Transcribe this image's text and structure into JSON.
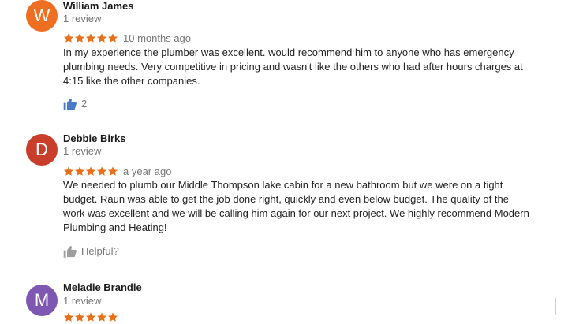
{
  "reviews": [
    {
      "initial": "W",
      "avatar_color": "#ee6e22",
      "name": "William James",
      "count": "1 review",
      "stars": 5,
      "time": "10 months ago",
      "text": "In my experience the plumber was excellent. would recommend him to anyone who has emergency\nplumbing needs. Very competitive in pricing and wasn't like the others who had after hours charges at\n4:15 like the other companies.",
      "helpful": "2",
      "helpful_icon": "thumb-up-icon-active"
    },
    {
      "initial": "D",
      "avatar_color": "#c93d2b",
      "name": "Debbie Birks",
      "count": "1 review",
      "stars": 5,
      "time": "a year ago",
      "text": "We needed to plumb our Middle Thompson lake cabin for a new bathroom but we were on a tight\nbudget.  Raun was able to get the job done right, quickly and even below budget.  The quality of the\nwork was excellent and we will be calling him again for our next project.  We highly recommend Modern\nPlumbing and Heating!",
      "helpful": "Helpful?",
      "helpful_icon": "thumb-up-icon"
    },
    {
      "initial": "M",
      "avatar_color": "#7e57b2",
      "name": "Meladie Brandle",
      "count": "1 review",
      "stars": 5
    }
  ],
  "colors": {
    "star": "#e7711b",
    "like_active": "#4a7bc8",
    "like_inactive": "#9e9e9e"
  }
}
